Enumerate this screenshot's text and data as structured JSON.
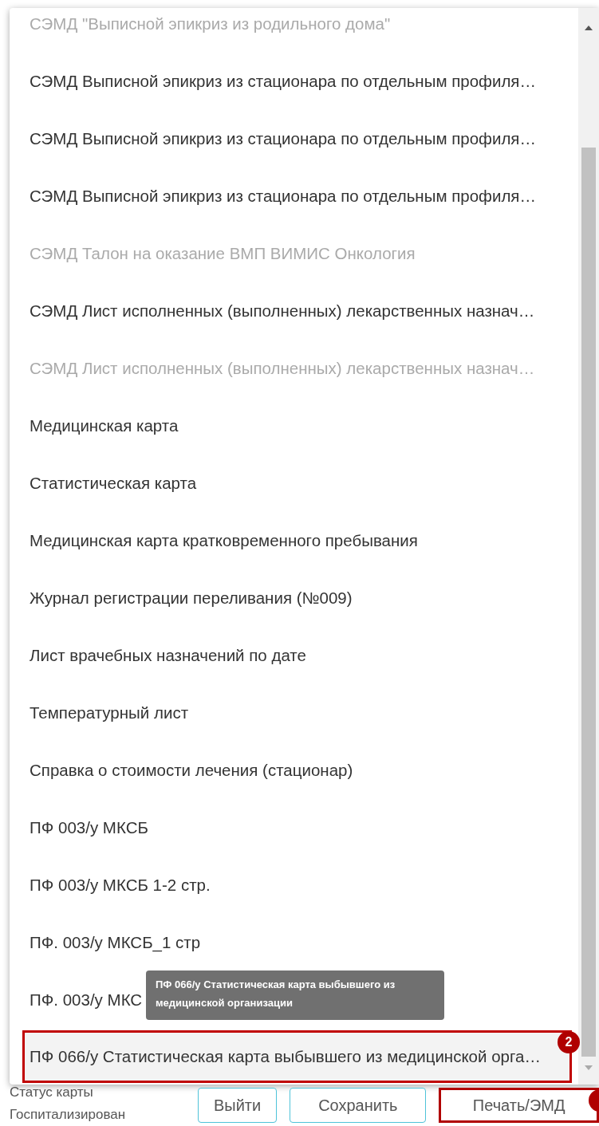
{
  "menu": {
    "items": [
      {
        "label": "СЭМД \"Выписной эпикриз из родильного дома\"",
        "disabled": true,
        "selected": false
      },
      {
        "label": "СЭМД Выписной эпикриз из стационара по отдельным профиля…",
        "disabled": false,
        "selected": false
      },
      {
        "label": "СЭМД Выписной эпикриз из стационара по отдельным профиля…",
        "disabled": false,
        "selected": false
      },
      {
        "label": "СЭМД Выписной эпикриз из стационара по отдельным профиля…",
        "disabled": false,
        "selected": false
      },
      {
        "label": "СЭМД Талон на оказание ВМП ВИМИС Онкология",
        "disabled": true,
        "selected": false
      },
      {
        "label": "СЭМД Лист исполненных (выполненных) лекарственных назнач…",
        "disabled": false,
        "selected": false
      },
      {
        "label": "СЭМД Лист исполненных (выполненных) лекарственных назнач…",
        "disabled": true,
        "selected": false
      },
      {
        "label": "Медицинская карта",
        "disabled": false,
        "selected": false
      },
      {
        "label": "Статистическая карта",
        "disabled": false,
        "selected": false
      },
      {
        "label": "Медицинская карта кратковременного пребывания",
        "disabled": false,
        "selected": false
      },
      {
        "label": "Журнал регистрации переливания (№009)",
        "disabled": false,
        "selected": false
      },
      {
        "label": "Лист врачебных назначений по дате",
        "disabled": false,
        "selected": false
      },
      {
        "label": "Температурный лист",
        "disabled": false,
        "selected": false
      },
      {
        "label": "Справка о стоимости лечения (стационар)",
        "disabled": false,
        "selected": false
      },
      {
        "label": "ПФ 003/у МКСБ",
        "disabled": false,
        "selected": false
      },
      {
        "label": "ПФ 003/у МКСБ 1-2 стр.",
        "disabled": false,
        "selected": false
      },
      {
        "label": "ПФ. 003/у МКСБ_1 стр",
        "disabled": false,
        "selected": false
      },
      {
        "label": "ПФ. 003/у МКС",
        "disabled": false,
        "selected": false
      },
      {
        "label": "ПФ 066/у Статистическая карта выбывшего из медицинской орга…",
        "disabled": false,
        "selected": true
      }
    ],
    "badge": "2",
    "tooltip": "ПФ 066/у Статистическая карта выбывшего из медицинской организации"
  },
  "status": {
    "label": "Статус карты",
    "value": "Госпитализирован"
  },
  "buttons": [
    {
      "label": "Выйти",
      "highlighted": false
    },
    {
      "label": "Сохранить",
      "highlighted": false
    },
    {
      "label": "Печать/ЭМД",
      "highlighted": true
    }
  ]
}
